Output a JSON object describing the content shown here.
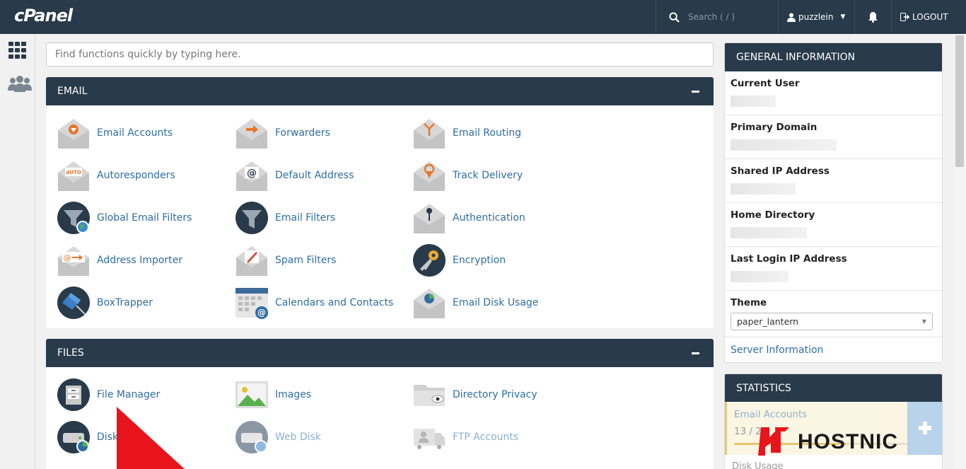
{
  "topbar": {
    "logo": "cPanel",
    "search_label": "Search ( / )",
    "username": "puzzlein",
    "logout_label": "LOGOUT"
  },
  "search": {
    "placeholder": "Find functions quickly by typing here."
  },
  "groups": [
    {
      "title": "EMAIL",
      "tools": [
        {
          "label": "Email Accounts",
          "icon": "email-accounts-icon"
        },
        {
          "label": "Forwarders",
          "icon": "forwarders-icon"
        },
        {
          "label": "Email Routing",
          "icon": "email-routing-icon"
        },
        {
          "label": "Autoresponders",
          "icon": "autoresponders-icon"
        },
        {
          "label": "Default Address",
          "icon": "default-address-icon"
        },
        {
          "label": "Track Delivery",
          "icon": "track-delivery-icon"
        },
        {
          "label": "Global Email Filters",
          "icon": "global-email-filters-icon"
        },
        {
          "label": "Email Filters",
          "icon": "email-filters-icon"
        },
        {
          "label": "Authentication",
          "icon": "authentication-icon"
        },
        {
          "label": "Address Importer",
          "icon": "address-importer-icon"
        },
        {
          "label": "Spam Filters",
          "icon": "spam-filters-icon"
        },
        {
          "label": "Encryption",
          "icon": "encryption-icon"
        },
        {
          "label": "BoxTrapper",
          "icon": "boxtrapper-icon"
        },
        {
          "label": "Calendars and Contacts",
          "icon": "calendars-contacts-icon"
        },
        {
          "label": "Email Disk Usage",
          "icon": "email-disk-usage-icon"
        }
      ]
    },
    {
      "title": "FILES",
      "tools": [
        {
          "label": "File Manager",
          "icon": "file-manager-icon"
        },
        {
          "label": "Images",
          "icon": "images-icon"
        },
        {
          "label": "Directory Privacy",
          "icon": "directory-privacy-icon"
        },
        {
          "label": "Disk",
          "icon": "disk-usage-icon"
        },
        {
          "label": "Web Disk",
          "icon": "web-disk-icon"
        },
        {
          "label": "FTP Accounts",
          "icon": "ftp-accounts-icon"
        }
      ]
    }
  ],
  "general_info": {
    "title": "GENERAL INFORMATION",
    "rows": [
      {
        "label": "Current User"
      },
      {
        "label": "Primary Domain"
      },
      {
        "label": "Shared IP Address"
      },
      {
        "label": "Home Directory"
      },
      {
        "label": "Last Login IP Address"
      }
    ],
    "theme_label": "Theme",
    "theme_value": "paper_lantern",
    "server_info_link": "Server Information"
  },
  "statistics": {
    "title": "STATISTICS",
    "email_accounts_label": "Email Accounts",
    "email_accounts_value": "13 / 20",
    "disk_usage_label": "Disk Usage"
  },
  "watermark": "HOSTNIC",
  "colors": {
    "header": "#293a4a",
    "link": "#2f6da4",
    "accent_orange": "#e8762c",
    "watermark_red": "#e8141c"
  }
}
